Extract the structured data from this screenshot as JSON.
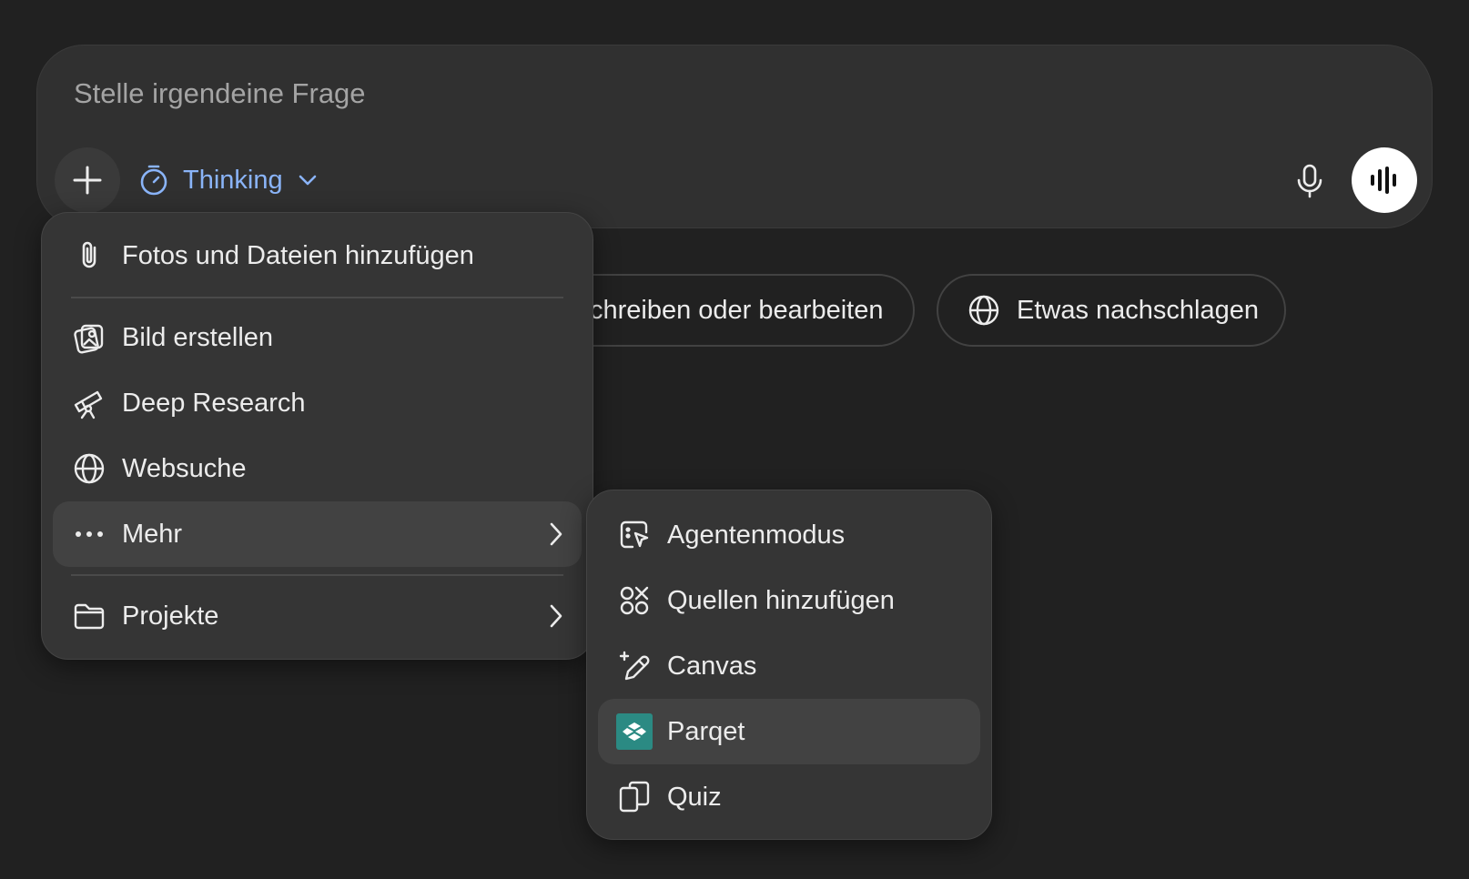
{
  "composer": {
    "placeholder": "Stelle irgendeine Frage",
    "model_label": "Thinking"
  },
  "suggestions": [
    {
      "label": "chreiben oder bearbeiten",
      "icon": "pen-icon"
    },
    {
      "label": "Etwas nachschlagen",
      "icon": "globe-icon"
    }
  ],
  "menu": {
    "attach": "Fotos und Dateien hinzufügen",
    "create_image": "Bild erstellen",
    "deep_research": "Deep Research",
    "web_search": "Websuche",
    "more": "Mehr",
    "projects": "Projekte"
  },
  "submenu": {
    "agent_mode": "Agentenmodus",
    "add_sources": "Quellen hinzufügen",
    "canvas": "Canvas",
    "parqet": "Parqet",
    "quiz": "Quiz"
  },
  "colors": {
    "background": "#212121",
    "composer": "#303030",
    "menu": "#353535",
    "highlight": "#424242",
    "accent_blue": "#8ab4f8",
    "parqet_teal": "#2b8a83"
  }
}
